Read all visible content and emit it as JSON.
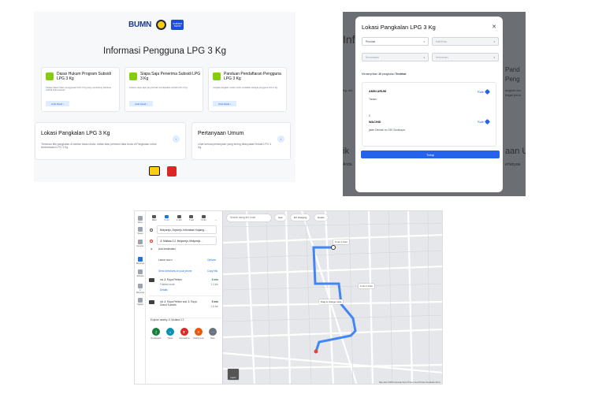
{
  "info_page": {
    "logos": {
      "bumn": "BUMN",
      "tepat": "SUBSIDI TEPAT"
    },
    "title": "Informasi Pengguna LPG 3 Kg",
    "cards": [
      {
        "title": "Dasar Hukum Program Subsidi LPG 3 Kg",
        "desc": "Pelajari dasar hukum penggunaan LPG 3 Kg yang mendukung distribusi subsidi tepat sasaran.",
        "button": "Lihat Detail",
        "icon": "scale-icon"
      },
      {
        "title": "Siapa Saja Penerima Subsidi LPG 3 Kg",
        "desc": "Ketahui siapa saja yang berhak mendapatkan subsidi LPG 3 Kg.",
        "button": "Lihat Detail",
        "icon": "people-icon"
      },
      {
        "title": "Panduan Pendaftaran Pengguna LPG 3 Kg",
        "desc": "Langkah-langkah mudah untuk mendaftar sebagai pengguna LPG 3 Kg.",
        "button": "Lihat Detail",
        "icon": "book-icon"
      }
    ],
    "lokasi": {
      "title": "Lokasi Pangkalan LPG 3 Kg",
      "desc": "Temukan titik pangkalan di sekitar lokasi Anda, daftar atau perbarui data Anda di Pangkalan untuk bertransaksi LPG 3 Kg."
    },
    "faq": {
      "title": "Pertanyaan Umum",
      "desc": "Lihat semua pertanyaan yang sering ditanyakan terkait LPG 3 Kg."
    }
  },
  "modal_page": {
    "bg_texts": [
      "Inf",
      "Pand",
      "Peng",
      "Kg. tek",
      "angkah-lan",
      "bagai pena",
      "ik",
      "aan Um",
      "an",
      "Anda",
      "ertanyaa"
    ],
    "title": "Lokasi Pangkalan LPG 3 Kg",
    "close": "✕",
    "selects": {
      "provinsi": "Provinsi",
      "kabkota": "Kab/Kota",
      "kecamatan": "Kecamatan",
      "kelurahan": "Kelurahan"
    },
    "result_prefix": "Menampilkan ",
    "result_count": "10",
    "result_mid": " pangkalan ",
    "result_suffix": "Terdekat",
    "items": [
      {
        "name": "AMIN ARUM",
        "addr": "Tanaru",
        "route": "Rute"
      },
      {
        "num": "1",
        "name": "WACHID",
        "addr": "jalan Demak no 240 Surabaya",
        "route": "Rute"
      }
    ],
    "close_button": "Tutup"
  },
  "maps_page": {
    "rail": [
      "Menu",
      "Saved",
      "Recents",
      "",
      "Mulyorejo",
      "Sidoarjo",
      "Jl. Mulyorejo",
      "Ngagel"
    ],
    "modes": [
      {
        "label": "Best",
        "active": false
      },
      {
        "label": "5 min",
        "active": true
      },
      {
        "label": "1 min",
        "active": false
      },
      {
        "label": "7 min",
        "active": false
      },
      {
        "label": "5 min",
        "active": false
      },
      {
        "label": "—",
        "active": false
      }
    ],
    "origin": "Mulyorejo, Dryorejo, Kelurahan Kupang...",
    "destination": "Jl. Mutiara 3 2, Mulyorejo, Mulyorejo...",
    "add_destination": "Add destination",
    "leave_now": "Leave now ▾",
    "options": "Options",
    "send_directions": "Send directions to your phone",
    "copy_link": "Copy link",
    "routes": [
      {
        "via": "via Jl. Raya Petiken",
        "time": "5 min",
        "sub": "Fastest route",
        "dist": "1.3 km",
        "details": "Details"
      },
      {
        "via": "via Jl. Raya Petiken and Jl. Raya Grand Kumala",
        "time": "5 min",
        "sub": "",
        "dist": "1.6 km",
        "details": ""
      }
    ],
    "explore": "Explore nearby Jl. Mutiara 3 2",
    "explore_items": [
      "Restaurants",
      "Hotels",
      "Gas stations",
      "Parking Lots",
      "More"
    ],
    "explore_colors": [
      "#15803d",
      "#0891b2",
      "#dc2626",
      "#ea580c",
      "#6b7280"
    ],
    "map": {
      "search_placeholder": "Search along the route",
      "chips": [
        "Gas",
        "EV charging",
        "Hotels"
      ],
      "route_tip": "5 min\n1.3 km",
      "route_tip2": "5 min\n1.6 km",
      "drag_tip": "Drag to change route",
      "layers": "Layers",
      "footer": "Map data ©2025  Indonesia  Terms  Privacy  Send Product Feedback  100 m"
    }
  }
}
